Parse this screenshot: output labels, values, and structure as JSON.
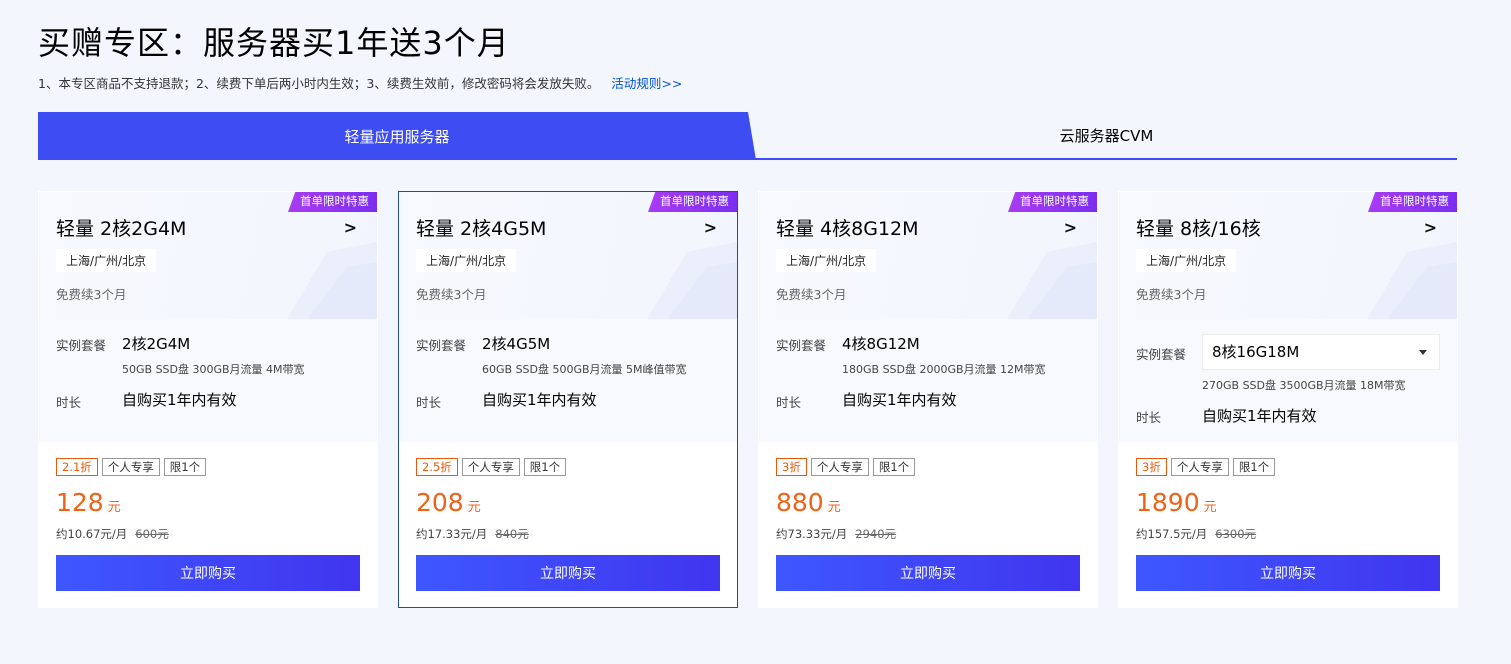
{
  "page": {
    "title": "买赠专区：服务器买1年送3个月",
    "notes": "1、本专区商品不支持退款；2、续费下单后两小时内生效；3、续费生效前，修改密码将会发放失败。",
    "rules_link": "活动规则>>"
  },
  "tabs": [
    {
      "label": "轻量应用服务器",
      "active": true
    },
    {
      "label": "云服务器CVM",
      "active": false
    }
  ],
  "colors": {
    "accent": "#3d4cf3",
    "price": "#ef6318",
    "badge": "#9b37f2"
  },
  "labels": {
    "package": "实例套餐",
    "duration": "时长",
    "buy": "立即购买",
    "unit": "元"
  },
  "cards": [
    {
      "badge": "首单限时特惠",
      "name": "轻量 2核2G4M",
      "region": "上海/广州/北京",
      "renew": "免费续3个月",
      "spec": "2核2G4M",
      "spec_desc": "50GB SSD盘 300GB月流量 4M带宽",
      "duration": "自购买1年内有效",
      "tags": [
        "2.1折",
        "个人专享",
        "限1个"
      ],
      "price": "128",
      "per_month": "约10.67元/月",
      "original": "600元"
    },
    {
      "badge": "首单限时特惠",
      "name": "轻量 2核4G5M",
      "region": "上海/广州/北京",
      "renew": "免费续3个月",
      "spec": "2核4G5M",
      "spec_desc": "60GB SSD盘 500GB月流量 5M峰值带宽",
      "duration": "自购买1年内有效",
      "tags": [
        "2.5折",
        "个人专享",
        "限1个"
      ],
      "price": "208",
      "per_month": "约17.33元/月",
      "original": "840元"
    },
    {
      "badge": "首单限时特惠",
      "name": "轻量 4核8G12M",
      "region": "上海/广州/北京",
      "renew": "免费续3个月",
      "spec": "4核8G12M",
      "spec_desc": "180GB SSD盘 2000GB月流量 12M带宽",
      "duration": "自购买1年内有效",
      "tags": [
        "3折",
        "个人专享",
        "限1个"
      ],
      "price": "880",
      "per_month": "约73.33元/月",
      "original": "2940元"
    },
    {
      "badge": "首单限时特惠",
      "name": "轻量 8核/16核",
      "region": "上海/广州/北京",
      "renew": "免费续3个月",
      "spec": "8核16G18M",
      "spec_desc": "270GB SSD盘 3500GB月流量 18M带宽",
      "duration": "自购买1年内有效",
      "tags": [
        "3折",
        "个人专享",
        "限1个"
      ],
      "price": "1890",
      "per_month": "约157.5元/月",
      "original": "6300元"
    }
  ]
}
